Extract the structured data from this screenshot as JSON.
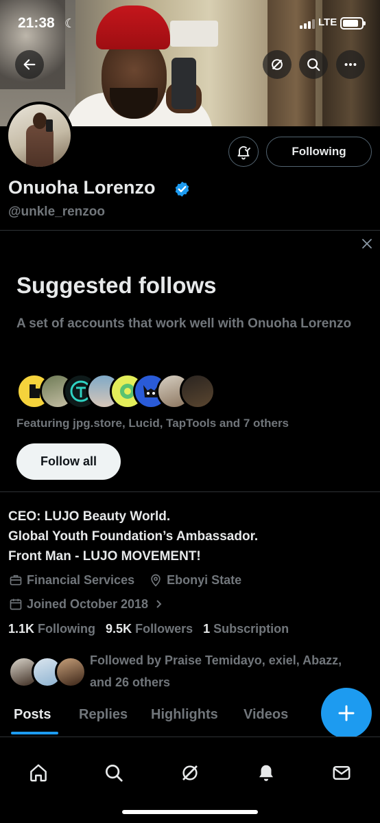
{
  "status_bar": {
    "time": "21:38",
    "network": "LTE"
  },
  "profile": {
    "name": "Onuoha Lorenzo",
    "handle": "@unkle_renzoo",
    "following_button": "Following",
    "bio_lines": [
      "CEO: LUJO Beauty World.",
      "Global Youth Foundation’s Ambassador.",
      "Front Man - LUJO MOVEMENT!"
    ],
    "category": "Financial Services",
    "location": "Ebonyi State",
    "joined": "Joined October 2018",
    "stats": {
      "following_count": "1.1K",
      "following_label": "Following",
      "followers_count": "9.5K",
      "followers_label": "Followers",
      "subscription_count": "1",
      "subscription_label": "Subscription"
    },
    "followed_by_line1": "Followed by Praise Temidayo, exiel, Abazz,",
    "followed_by_line2": "and 26 others"
  },
  "suggested": {
    "title": "Suggested follows",
    "description": "A set of accounts that work well with Onuoha Lorenzo",
    "featuring": "Featuring jpg.store, Lucid, TapTools and 7 others",
    "follow_all": "Follow all"
  },
  "tabs": [
    "Posts",
    "Replies",
    "Highlights",
    "Videos"
  ],
  "icons": {
    "back": "back-arrow-icon",
    "grok": "grok-icon",
    "search": "search-icon",
    "more": "more-icon",
    "bell": "notification-bell-icon",
    "verified": "verified-badge-icon",
    "close": "close-icon",
    "briefcase": "briefcase-icon",
    "location": "location-pin-icon",
    "calendar": "calendar-icon",
    "compose": "compose-plus-icon"
  },
  "colors": {
    "accent": "#1d9bf0",
    "background": "#000000",
    "muted": "#71767b"
  }
}
